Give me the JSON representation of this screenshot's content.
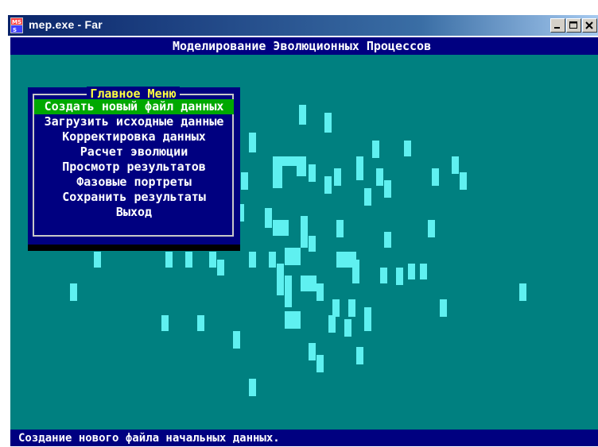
{
  "window": {
    "title": "mep.exe - Far",
    "icon": "ms-dos-icon",
    "buttons": [
      "minimize",
      "restore",
      "close"
    ]
  },
  "header": {
    "title": "Моделирование Эволюционных Процессов"
  },
  "menu": {
    "title": "Главное Меню",
    "selected_index": 0,
    "items": [
      "Создать новый файл данных",
      "Загрузить исходные данные",
      "Корректировка данных",
      "Расчет эволюции",
      "Просмотр результатов",
      "Фазовые портреты",
      "Сохранить результаты",
      "Выход"
    ]
  },
  "status": {
    "text": "Создание нового файла начальных данных."
  },
  "colors": {
    "background": "#008080",
    "cell": "#5ff0f0",
    "bars": "#000080",
    "selection": "#00a800",
    "menu_title": "#ffff40"
  }
}
